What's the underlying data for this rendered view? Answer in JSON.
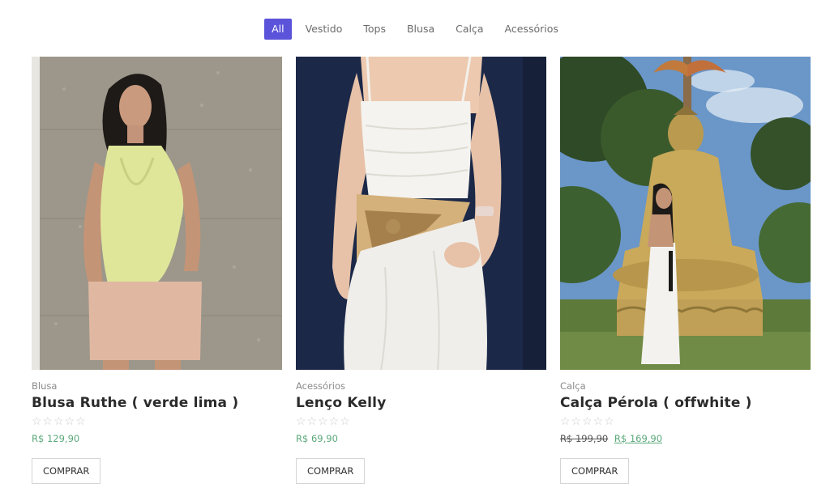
{
  "filters": [
    "All",
    "Vestido",
    "Tops",
    "Blusa",
    "Calça",
    "Acessórios"
  ],
  "products": [
    {
      "category": "Blusa",
      "name": "Blusa Ruthe ( verde lima )",
      "rating": 0,
      "price": "R$ 129,90",
      "button": "COMPRAR"
    },
    {
      "category": "Acessórios",
      "name": "Lenço Kelly",
      "rating": 0,
      "price": "R$ 69,90",
      "button": "COMPRAR"
    },
    {
      "category": "Calça",
      "name": "Calça Pérola ( offwhite )",
      "rating": 0,
      "old_price": "R$ 199,90",
      "price": "R$ 169,90",
      "button": "COMPRAR"
    }
  ],
  "stars": "☆☆☆☆☆",
  "colors": {
    "accent": "#5b53d9",
    "price_green": "#5aa87a"
  }
}
